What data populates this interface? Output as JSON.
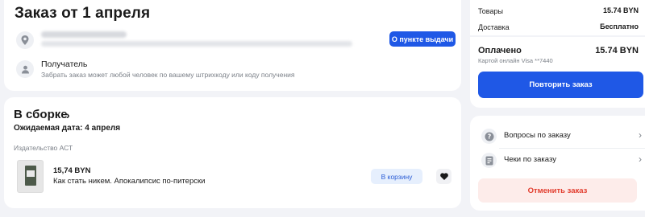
{
  "order": {
    "title": "Заказ от 1 апреля",
    "address": {
      "icon": "location-pin-icon",
      "line1": "",
      "line2": ""
    },
    "pickup_button": "О пункте выдачи",
    "recipient": {
      "icon": "person-icon",
      "title": "Получатель",
      "subtitle": "Забрать заказ может любой человек по вашему штрихкоду или коду получения"
    }
  },
  "assembly": {
    "title": "В сборке",
    "chevron": "›",
    "expected_date": "Ожидаемая дата: 4 апреля",
    "publisher": "Издательство АСТ",
    "item": {
      "price": "15,74 BYN",
      "name": "Как стать никем. Апокалипсис по-питерски",
      "cart_button": "В корзину",
      "favorite_icon": "heart-icon"
    }
  },
  "summary": {
    "goods_label": "Товары",
    "goods_value": "15.74 BYN",
    "delivery_label": "Доставка",
    "delivery_value": "Бесплатно",
    "paid_label": "Оплачено",
    "paid_value": "15.74 BYN",
    "card_info": "Картой онлайн Visa **7440",
    "repeat_button": "Повторить заказ"
  },
  "actions": {
    "questions": {
      "label": "Вопросы по заказу",
      "icon": "question-icon"
    },
    "receipts": {
      "label": "Чеки по заказу",
      "icon": "receipt-icon"
    },
    "cancel_button": "Отменить заказ"
  },
  "colors": {
    "accent": "#1f58e6",
    "page_bg": "#f2f3f7",
    "cancel_bg": "#fdecea",
    "cancel_text": "#e23d2e",
    "cart_bg": "#e6effd"
  }
}
